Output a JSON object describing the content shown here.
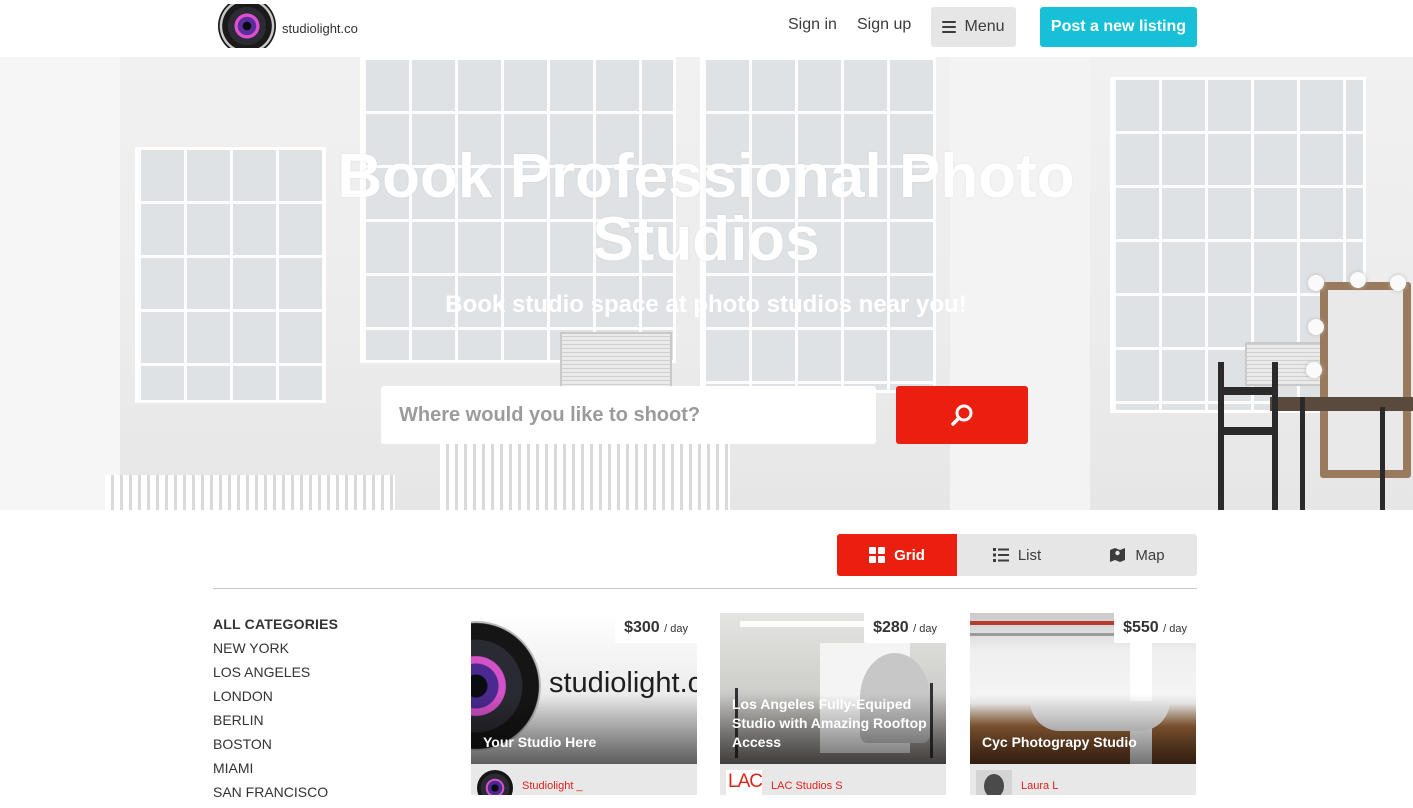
{
  "brand": {
    "name": "studiolight.co"
  },
  "nav": {
    "sign_in": "Sign in",
    "sign_up": "Sign up",
    "menu": "Menu",
    "post_listing": "Post a new listing"
  },
  "hero": {
    "title": "Book Professional Photo Studios",
    "subtitle": "Book studio space at photo studios near you!",
    "search_placeholder": "Where would you like to shoot?"
  },
  "view_toggle": {
    "options": [
      {
        "label": "Grid",
        "icon": "grid-icon",
        "active": true
      },
      {
        "label": "List",
        "icon": "list-icon",
        "active": false
      },
      {
        "label": "Map",
        "icon": "map-icon",
        "active": false
      }
    ]
  },
  "categories": {
    "heading": "ALL CATEGORIES",
    "items": [
      "NEW YORK",
      "LOS ANGELES",
      "LONDON",
      "BERLIN",
      "BOSTON",
      "MIAMI",
      "SAN FRANCISCO"
    ]
  },
  "listings": [
    {
      "title": "Your Studio Here",
      "price": "$300",
      "per": "/ day",
      "author": "Studiolight _"
    },
    {
      "title": "Los Angeles Fully-Equiped Studio with Amazing Rooftop Access",
      "price": "$280",
      "per": "/ day",
      "author": "LAC Studios S",
      "logo_text": "LAC"
    },
    {
      "title": "Cyc Photograpy Studio",
      "price": "$550",
      "per": "/ day",
      "author": "Laura L"
    }
  ],
  "colors": {
    "accent_red": "#ea1f0f",
    "cta_cyan": "#17c0d6",
    "author_red": "#e0201a"
  }
}
